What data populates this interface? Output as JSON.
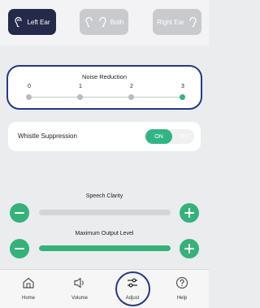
{
  "ear_selector": {
    "left_label": "Left Ear",
    "both_label": "Both",
    "right_label": "Right Ear",
    "selected": "left"
  },
  "noise_reduction": {
    "title": "Noise Reduction",
    "levels": [
      "0",
      "1",
      "2",
      "3"
    ],
    "selected_level": 3
  },
  "whistle_suppression": {
    "label": "Whistle Suppression",
    "on_label": "ON",
    "off_label": "OFF",
    "state": "on"
  },
  "speech_clarity": {
    "label": "Speech Clarity",
    "level": 0.0
  },
  "max_output": {
    "label": "Maximum Output Level",
    "level": 1.0
  },
  "tabs": [
    {
      "label": "Home",
      "icon": "home-icon"
    },
    {
      "label": "Volume",
      "icon": "speaker-icon"
    },
    {
      "label": "Adjust",
      "icon": "sliders-icon"
    },
    {
      "label": "Help",
      "icon": "question-icon"
    }
  ],
  "colors": {
    "accent_green": "#34b27a",
    "active_dark": "#232a4a",
    "highlight_ring": "#233a84"
  }
}
